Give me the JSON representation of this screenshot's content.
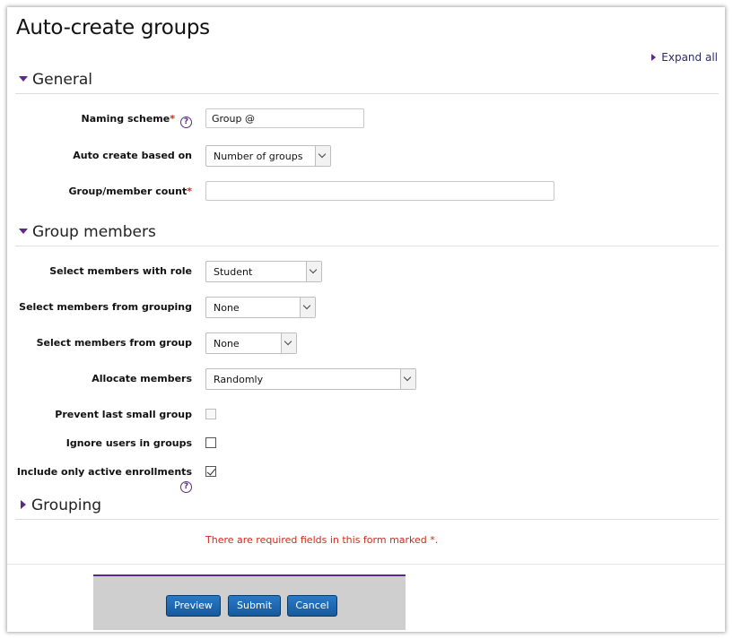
{
  "page": {
    "title": "Auto-create groups",
    "expand_all": "Expand all"
  },
  "sections": {
    "general": "General",
    "group_members": "Group members",
    "grouping": "Grouping"
  },
  "general": {
    "naming_scheme_label": "Naming scheme",
    "naming_scheme_value": "Group @",
    "auto_create_label": "Auto create based on",
    "auto_create_value": "Number of groups",
    "count_label": "Group/member count",
    "count_value": ""
  },
  "members": {
    "role_label": "Select members with role",
    "role_value": "Student",
    "grouping_label": "Select members from grouping",
    "grouping_value": "None",
    "group_label": "Select members from group",
    "group_value": "None",
    "allocate_label": "Allocate members",
    "allocate_value": "Randomly",
    "prevent_label": "Prevent last small group",
    "prevent_checked": false,
    "ignore_label": "Ignore users in groups",
    "ignore_checked": false,
    "active_label": "Include only active enrollments",
    "active_checked": true
  },
  "required_marker": "*",
  "required_note": "There are required fields in this form marked *.",
  "buttons": {
    "preview": "Preview",
    "submit": "Submit",
    "cancel": "Cancel"
  },
  "colors": {
    "accent": "#5b2a86",
    "required": "#cc2a1d",
    "button": "#1f6ab3"
  }
}
